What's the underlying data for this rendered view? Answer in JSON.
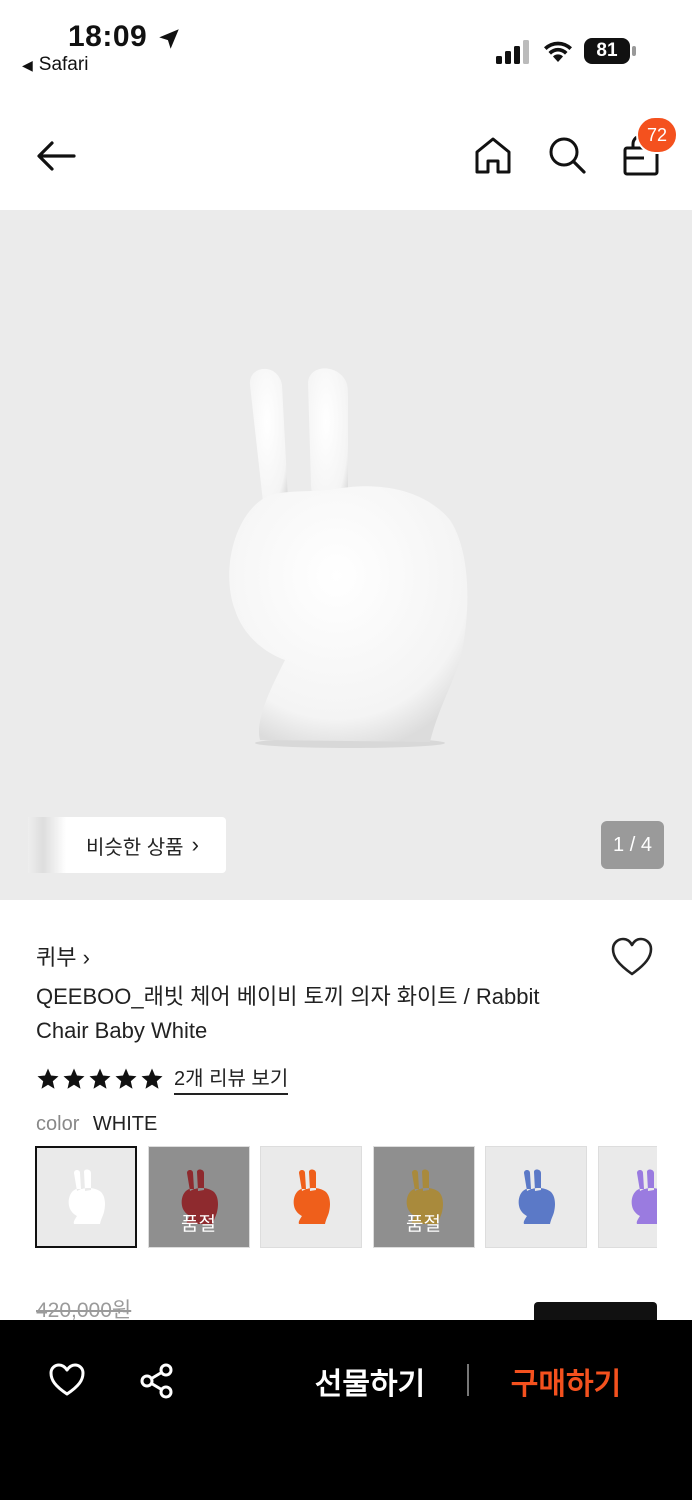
{
  "status_bar": {
    "time": "18:09",
    "back_app": "Safari",
    "battery": "81"
  },
  "header": {
    "cart_count": "72",
    "icons": [
      "back-arrow-icon",
      "home-icon",
      "search-icon",
      "shopping-bag-icon"
    ]
  },
  "gallery": {
    "similar_label": "비슷한 상품",
    "page_counter": "1 / 4"
  },
  "product": {
    "brand": "퀴부",
    "title": "QEEBOO_래빗 체어 베이비 토끼 의자 화이트 / Rabbit Chair Baby White",
    "rating_stars": 5,
    "review_link": "2개 리뷰 보기",
    "color_label": "color",
    "color_value": "WHITE",
    "original_price": "420,000원"
  },
  "swatches": [
    {
      "color": "#ffffff",
      "selected": true,
      "soldout": false
    },
    {
      "color": "#8e2a2e",
      "selected": false,
      "soldout": true,
      "label": "품절"
    },
    {
      "color": "#ef5f1b",
      "selected": false,
      "soldout": false
    },
    {
      "color": "#a98a3c",
      "selected": false,
      "soldout": true,
      "label": "품절"
    },
    {
      "color": "#5b79c7",
      "selected": false,
      "soldout": false
    },
    {
      "color": "#9a7be0",
      "selected": false,
      "soldout": false
    }
  ],
  "bottom_bar": {
    "gift_label": "선물하기",
    "buy_label": "구매하기"
  },
  "colors": {
    "accent": "#f4511e",
    "bottom_bar_bg": "#000000"
  }
}
